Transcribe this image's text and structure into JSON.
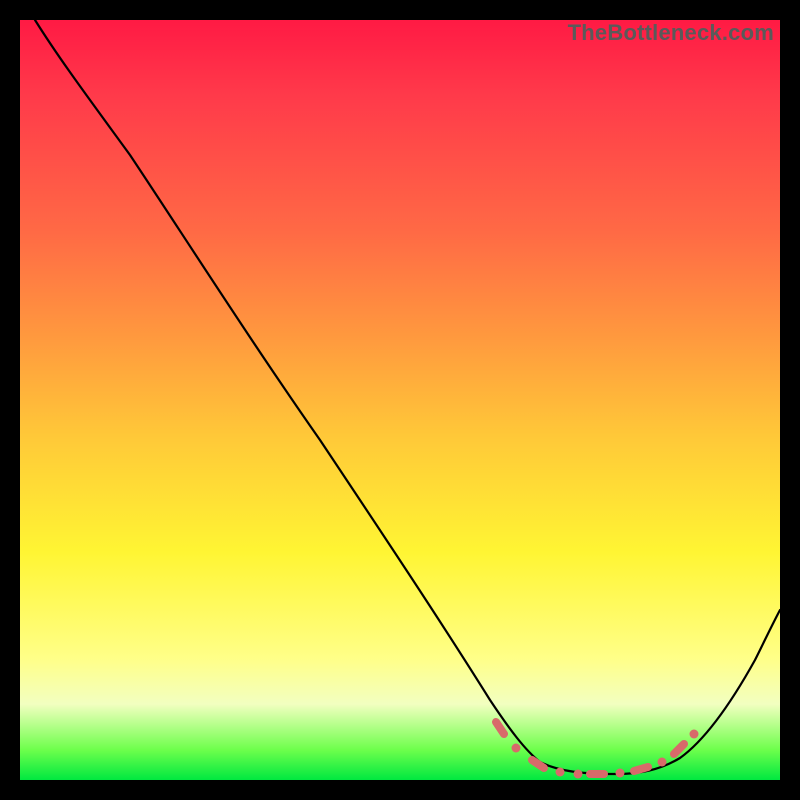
{
  "watermark": "TheBottleneck.com",
  "chart_data": {
    "type": "line",
    "title": "",
    "xlabel": "",
    "ylabel": "",
    "xlim": [
      0,
      100
    ],
    "ylim": [
      0,
      100
    ],
    "grid": false,
    "legend": false,
    "background": "rainbow-vertical-gradient",
    "series": [
      {
        "name": "bottleneck-curve",
        "x": [
          2,
          5,
          8,
          12,
          18,
          25,
          32,
          40,
          48,
          55,
          60,
          63,
          66,
          70,
          74,
          78,
          82,
          85,
          88,
          92,
          96,
          100
        ],
        "y": [
          100,
          98,
          96,
          93,
          87,
          79,
          70,
          60,
          49,
          39,
          30,
          22,
          14,
          6,
          2,
          1,
          1,
          2,
          5,
          11,
          18,
          26
        ]
      }
    ],
    "markers": {
      "name": "highlight-dots",
      "color": "#d86a6a",
      "points": [
        {
          "x": 63,
          "y": 8
        },
        {
          "x": 65,
          "y": 5
        },
        {
          "x": 69,
          "y": 2
        },
        {
          "x": 72,
          "y": 1
        },
        {
          "x": 75,
          "y": 1
        },
        {
          "x": 78,
          "y": 1
        },
        {
          "x": 81,
          "y": 1
        },
        {
          "x": 84,
          "y": 2
        },
        {
          "x": 87,
          "y": 4
        },
        {
          "x": 89,
          "y": 7
        }
      ]
    }
  }
}
